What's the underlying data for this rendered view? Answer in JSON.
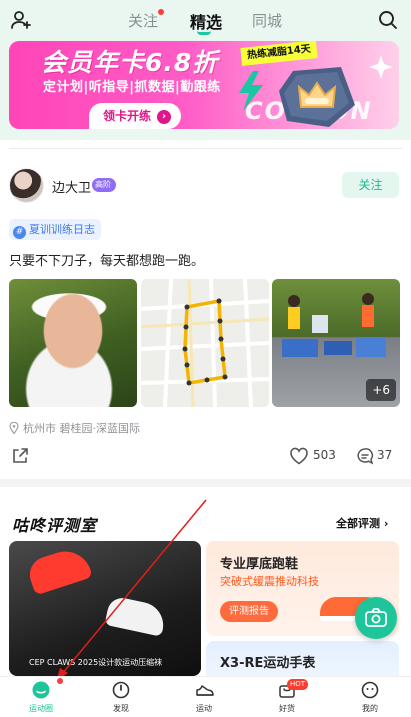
{
  "header": {
    "tabs": [
      {
        "label": "关注",
        "has_dot": true
      },
      {
        "label": "精选",
        "active": true
      },
      {
        "label": "同城"
      }
    ],
    "left_icon": "add-friend-icon",
    "right_icon": "search-icon"
  },
  "banner": {
    "title": "会员年卡6.8折",
    "subtitle": "定计划|听指导|抓数据|勤跟练",
    "cta": "领卡开练",
    "tag": "热练减脂14天",
    "coupon_text": "COUPON"
  },
  "post": {
    "username": "边大卫",
    "level": "高阶",
    "follow_label": "关注",
    "topic": "夏训训练日志",
    "text": "只要不下刀子，每天都想跑一跑。",
    "more_photos": "+6",
    "location": "杭州市 碧桂园·深蓝国际",
    "likes": "503",
    "comments": "37"
  },
  "lab": {
    "title": "咕咚评测室",
    "all_label": "全部评测",
    "left_caption": "CEP CLAWS 2025设计款运动压缩袜",
    "card1": {
      "title": "专业厚底跑鞋",
      "subtitle": "突破式缓震推动科技",
      "button": "评测报告"
    },
    "card2": {
      "title": "X3-RE运动手表"
    }
  },
  "bottom_nav": [
    {
      "label": "运动圈",
      "icon": "community-icon",
      "active": true,
      "has_dot": true
    },
    {
      "label": "发现",
      "icon": "compass-icon"
    },
    {
      "label": "运动",
      "icon": "running-shoe-icon"
    },
    {
      "label": "好货",
      "icon": "shopping-bag-icon",
      "badge": "HOT"
    },
    {
      "label": "我的",
      "icon": "profile-icon"
    }
  ],
  "colors": {
    "accent": "#1dc8a0",
    "banner_pink": "#ff45b8",
    "badge_purple": "#8f6cf5",
    "annotation_red": "#e11d1d"
  }
}
